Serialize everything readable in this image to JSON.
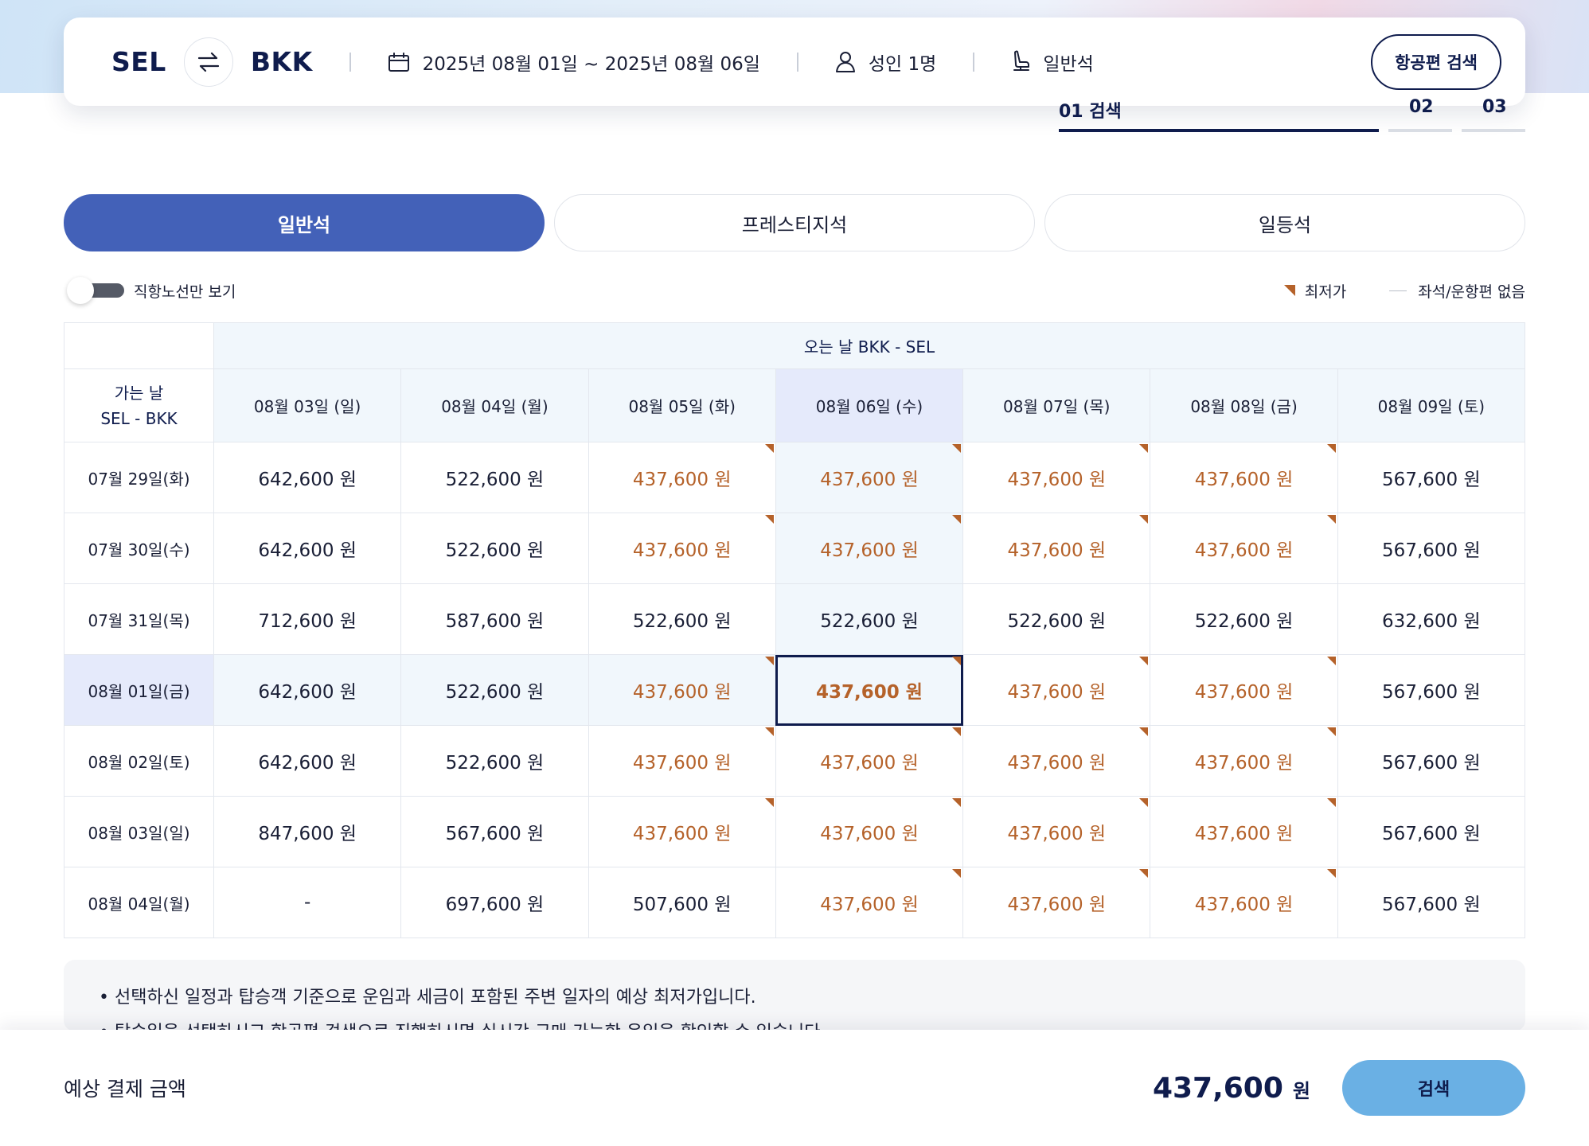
{
  "search": {
    "origin": "SEL",
    "destination": "BKK",
    "dates": "2025년 08월 01일 ~ 2025년 08월 06일",
    "passengers": "성인 1명",
    "cabin": "일반석",
    "search_button": "항공편 검색"
  },
  "steps": [
    {
      "label": "01 검색"
    },
    {
      "label": "02"
    },
    {
      "label": "03"
    }
  ],
  "tabs": [
    {
      "label": "일반석"
    },
    {
      "label": "프레스티지석"
    },
    {
      "label": "일등석"
    }
  ],
  "options": {
    "direct_only": "직항노선만 보기",
    "legend_lowest": "최저가",
    "legend_none": "좌석/운항편 없음"
  },
  "table": {
    "return_header": "오는 날 BKK - SEL",
    "depart_header_line1": "가는 날",
    "depart_header_line2": "SEL - BKK",
    "return_dates": [
      "08월 03일 (일)",
      "08월 04일 (월)",
      "08월 05일 (화)",
      "08월 06일 (수)",
      "08월 07일 (목)",
      "08월 08일 (금)",
      "08월 09일 (토)"
    ],
    "rows": [
      {
        "date": "07월 29일(화)",
        "fares": [
          "642,600 원",
          "522,600 원",
          "437,600 원",
          "437,600 원",
          "437,600 원",
          "437,600 원",
          "567,600 원"
        ]
      },
      {
        "date": "07월 30일(수)",
        "fares": [
          "642,600 원",
          "522,600 원",
          "437,600 원",
          "437,600 원",
          "437,600 원",
          "437,600 원",
          "567,600 원"
        ]
      },
      {
        "date": "07월 31일(목)",
        "fares": [
          "712,600 원",
          "587,600 원",
          "522,600 원",
          "522,600 원",
          "522,600 원",
          "522,600 원",
          "632,600 원"
        ]
      },
      {
        "date": "08월 01일(금)",
        "fares": [
          "642,600 원",
          "522,600 원",
          "437,600 원",
          "437,600 원",
          "437,600 원",
          "437,600 원",
          "567,600 원"
        ]
      },
      {
        "date": "08월 02일(토)",
        "fares": [
          "642,600 원",
          "522,600 원",
          "437,600 원",
          "437,600 원",
          "437,600 원",
          "437,600 원",
          "567,600 원"
        ]
      },
      {
        "date": "08월 03일(일)",
        "fares": [
          "847,600 원",
          "567,600 원",
          "437,600 원",
          "437,600 원",
          "437,600 원",
          "437,600 원",
          "567,600 원"
        ]
      },
      {
        "date": "08월 04일(월)",
        "fares": [
          "-",
          "697,600 원",
          "507,600 원",
          "437,600 원",
          "437,600 원",
          "437,600 원",
          "567,600 원"
        ]
      }
    ]
  },
  "notes": [
    "선택하신 일정과 탑승객 기준으로 운임과 세금이 포함된 주변 일자의 예상 최저가입니다.",
    "탑승일을 선택하시고 항공편 검색으로 진행하시면 실시간 구매 가능한 운임을 확인할 수 있습니다."
  ],
  "bottom": {
    "label": "예상 결제 금액",
    "amount": "437,600",
    "unit": "원",
    "button": "검색"
  },
  "colors": {
    "primary": "#4361b8",
    "navy": "#0f1c4d",
    "lowest": "#b5622a",
    "search_button": "#6ab0e4"
  }
}
